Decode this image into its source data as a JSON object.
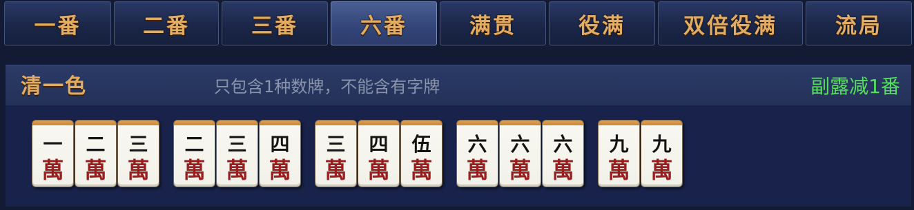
{
  "tabs": [
    {
      "label": "一番"
    },
    {
      "label": "二番"
    },
    {
      "label": "三番"
    },
    {
      "label": "六番",
      "active": true
    },
    {
      "label": "满贯"
    },
    {
      "label": "役满"
    },
    {
      "label": "双倍役满"
    },
    {
      "label": "流局"
    }
  ],
  "yaku": {
    "name": "清一色",
    "description": "只包含1种数牌，不能含有字牌",
    "open_penalty": "副露减1番"
  },
  "tiles": [
    {
      "num": "一",
      "suit": "萬"
    },
    {
      "num": "二",
      "suit": "萬"
    },
    {
      "num": "三",
      "suit": "萬"
    },
    {
      "num": "二",
      "suit": "萬"
    },
    {
      "num": "三",
      "suit": "萬"
    },
    {
      "num": "四",
      "suit": "萬"
    },
    {
      "num": "三",
      "suit": "萬"
    },
    {
      "num": "四",
      "suit": "萬"
    },
    {
      "num": "伍",
      "suit": "萬"
    },
    {
      "num": "六",
      "suit": "萬"
    },
    {
      "num": "六",
      "suit": "萬"
    },
    {
      "num": "六",
      "suit": "萬"
    },
    {
      "num": "九",
      "suit": "萬"
    },
    {
      "num": "九",
      "suit": "萬"
    }
  ],
  "colors": {
    "tab_text": "#e2ad63",
    "penalty_text": "#54e05c",
    "suit_red": "#9c1d1d"
  }
}
